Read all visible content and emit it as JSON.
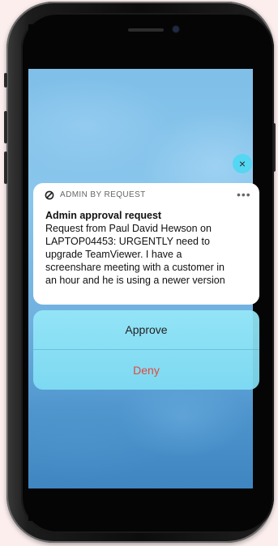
{
  "notification": {
    "app_name": "ADMIN BY REQUEST",
    "app_icon": "block-icon",
    "more_icon": "more-horizontal-icon",
    "more_glyph": "•••",
    "title": "Admin approval request",
    "body_lines": [
      "Request from Paul David Hewson on",
      "LAPTOP04453: URGENTLY need to",
      "upgrade TeamViewer. I have a",
      "screenshare meeting with a customer in",
      "an hour and he is using a newer version"
    ]
  },
  "actions": {
    "approve_label": "Approve",
    "deny_label": "Deny"
  },
  "close_button": {
    "icon": "close-icon",
    "glyph": "×"
  },
  "colors": {
    "close_bg": "#55d6f2",
    "action_bg": "#8fe4f6",
    "deny_text": "#e0493f",
    "page_bg": "#fdf0ef"
  }
}
